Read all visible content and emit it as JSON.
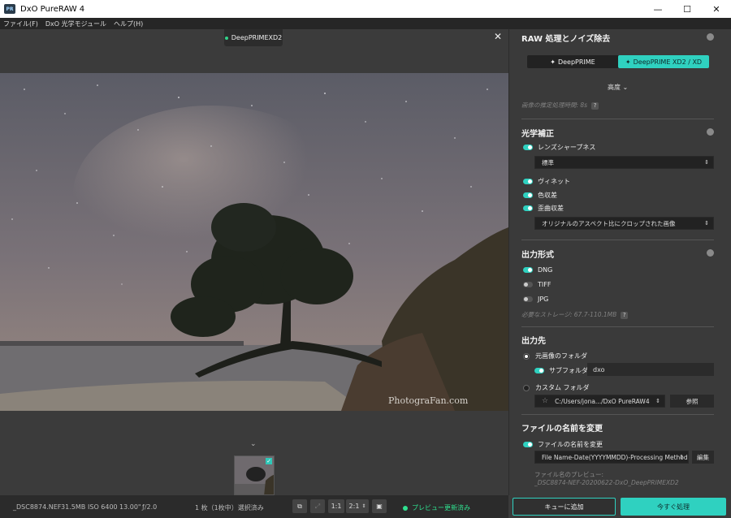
{
  "app": {
    "title": "DxO PureRAW 4",
    "logo": "PR"
  },
  "window": {
    "minimize": "—",
    "maximize": "☐",
    "close": "✕"
  },
  "menu": [
    "ファイル(F)",
    "DxO 光学モジュール",
    "ヘルプ(H)"
  ],
  "viewer": {
    "preview_label": "DeepPRIMEXD2",
    "close": "✕",
    "chevron": "⌄",
    "watermark": "PhotograFan.com"
  },
  "status": {
    "file": "_DSC8874.NEF",
    "size": "31.5MB",
    "iso": "ISO 6400",
    "shutter": "13.00\"",
    "aperture": "ƒ/2.0",
    "selection": "1 枚（1枚中）選択済み",
    "zoom_fit": "1:1",
    "zoom_level": "2:1",
    "preview_status": "プレビュー更新済み"
  },
  "panel": {
    "raw": {
      "title": "RAW 処理とノイズ除去",
      "modes": [
        "DeepPRIME",
        "DeepPRIME XD2 / XD"
      ],
      "advanced": "高度 ⌄",
      "estimate": "画像の推定処理時間: 8s"
    },
    "optics": {
      "title": "光学補正",
      "sharpness": "レンズシャープネス",
      "sharpness_value": "標準",
      "vignette": "ヴィネット",
      "chromatic": "色収差",
      "distortion": "歪曲収差",
      "distortion_value": "オリジナルのアスペクト比にクロップされた画像"
    },
    "output_format": {
      "title": "出力形式",
      "dng": "DNG",
      "tiff": "TIFF",
      "jpg": "JPG",
      "storage": "必要なストレージ: 67.7-110.1MB"
    },
    "destination": {
      "title": "出力先",
      "original_folder": "元画像のフォルダ",
      "subfolder": "サブフォルダ",
      "subfolder_value": "dxo",
      "custom_folder": "カスタム フォルダ",
      "custom_path": "C:/Users/jona.../DxO PureRAW4",
      "browse": "参照"
    },
    "rename": {
      "title": "ファイルの名前を変更",
      "toggle_label": "ファイルの名前を変更",
      "pattern": "File Name-Date(YYYYMMDD)-Processing Method",
      "edit": "編集",
      "preview_label": "ファイル名のプレビュー:",
      "preview_value": "_DSC8874-NEF-20200622-DxO_DeepPRIMEXD2"
    }
  },
  "actions": {
    "queue": "キューに追加",
    "process": "今すぐ処理"
  },
  "colors": {
    "accent": "#2fd1c0",
    "status_green": "#2fe08f"
  }
}
